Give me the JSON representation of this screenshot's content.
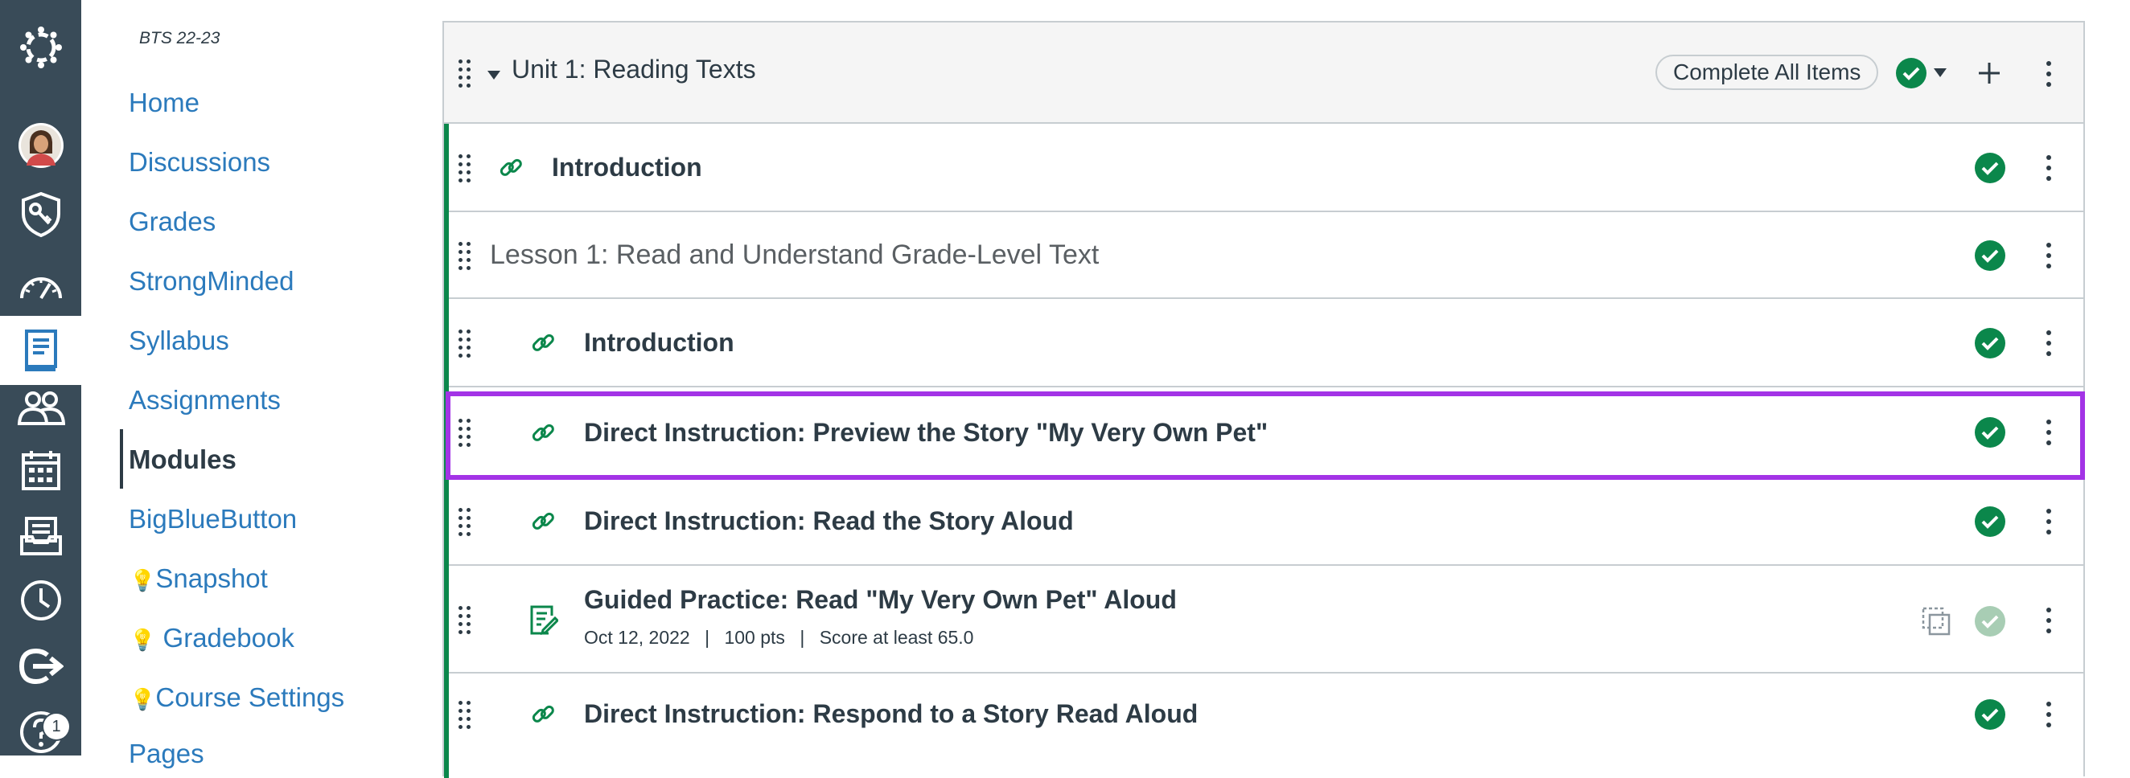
{
  "global_nav": {
    "items": [
      {
        "icon": "canvas-logo-icon"
      },
      {
        "icon": "account-avatar-icon"
      },
      {
        "icon": "admin-shield-icon"
      },
      {
        "icon": "dashboard-gauge-icon"
      },
      {
        "icon": "courses-book-icon"
      },
      {
        "icon": "groups-people-icon"
      },
      {
        "icon": "calendar-icon"
      },
      {
        "icon": "inbox-icon"
      },
      {
        "icon": "history-clock-icon"
      },
      {
        "icon": "commons-arrow-icon"
      },
      {
        "icon": "help-icon"
      }
    ],
    "help_badge": "1",
    "colors": {
      "background": "#394b58",
      "active": "#ffffff"
    }
  },
  "course_nav": {
    "course_code": "BTS 22-23",
    "links": [
      {
        "label": "Home"
      },
      {
        "label": "Discussions"
      },
      {
        "label": "Grades"
      },
      {
        "label": "StrongMinded"
      },
      {
        "label": "Syllabus"
      },
      {
        "label": "Assignments"
      },
      {
        "label": "Modules",
        "active": true
      },
      {
        "label": "BigBlueButton"
      },
      {
        "label": "Snapshot",
        "icon": "lightbulb-icon"
      },
      {
        "label": " Gradebook",
        "icon": "lightbulb-icon"
      },
      {
        "label": "Course Settings",
        "icon": "lightbulb-icon"
      },
      {
        "label": "Pages"
      }
    ],
    "link_color": "#2b7abc"
  },
  "module": {
    "title": "Unit 1: Reading Texts",
    "complete_all_label": "Complete All Items",
    "published_color": "#0b874b",
    "items": [
      {
        "type": "link",
        "title": "Introduction",
        "icon": "link-icon"
      },
      {
        "type": "subheader",
        "title": "Lesson 1: Read and Understand Grade-Level Text"
      },
      {
        "type": "link",
        "title": "Introduction",
        "icon": "link-icon"
      },
      {
        "type": "link",
        "title": "Direct Instruction: Preview the Story \"My Very Own Pet\"",
        "icon": "link-icon",
        "highlighted": true
      },
      {
        "type": "link",
        "title": "Direct Instruction: Read the Story Aloud",
        "icon": "link-icon"
      },
      {
        "type": "assignment",
        "title": "Guided Practice: Read \"My Very Own Pet\" Aloud",
        "icon": "assignment-icon",
        "meta": {
          "date": "Oct 12, 2022",
          "points": "100 pts",
          "requirement": "Score at least 65.0",
          "separator": "|"
        }
      },
      {
        "type": "link",
        "title": "Direct Instruction: Respond to a Story Read Aloud",
        "icon": "link-icon"
      }
    ],
    "highlight_color": "#a333e6"
  }
}
